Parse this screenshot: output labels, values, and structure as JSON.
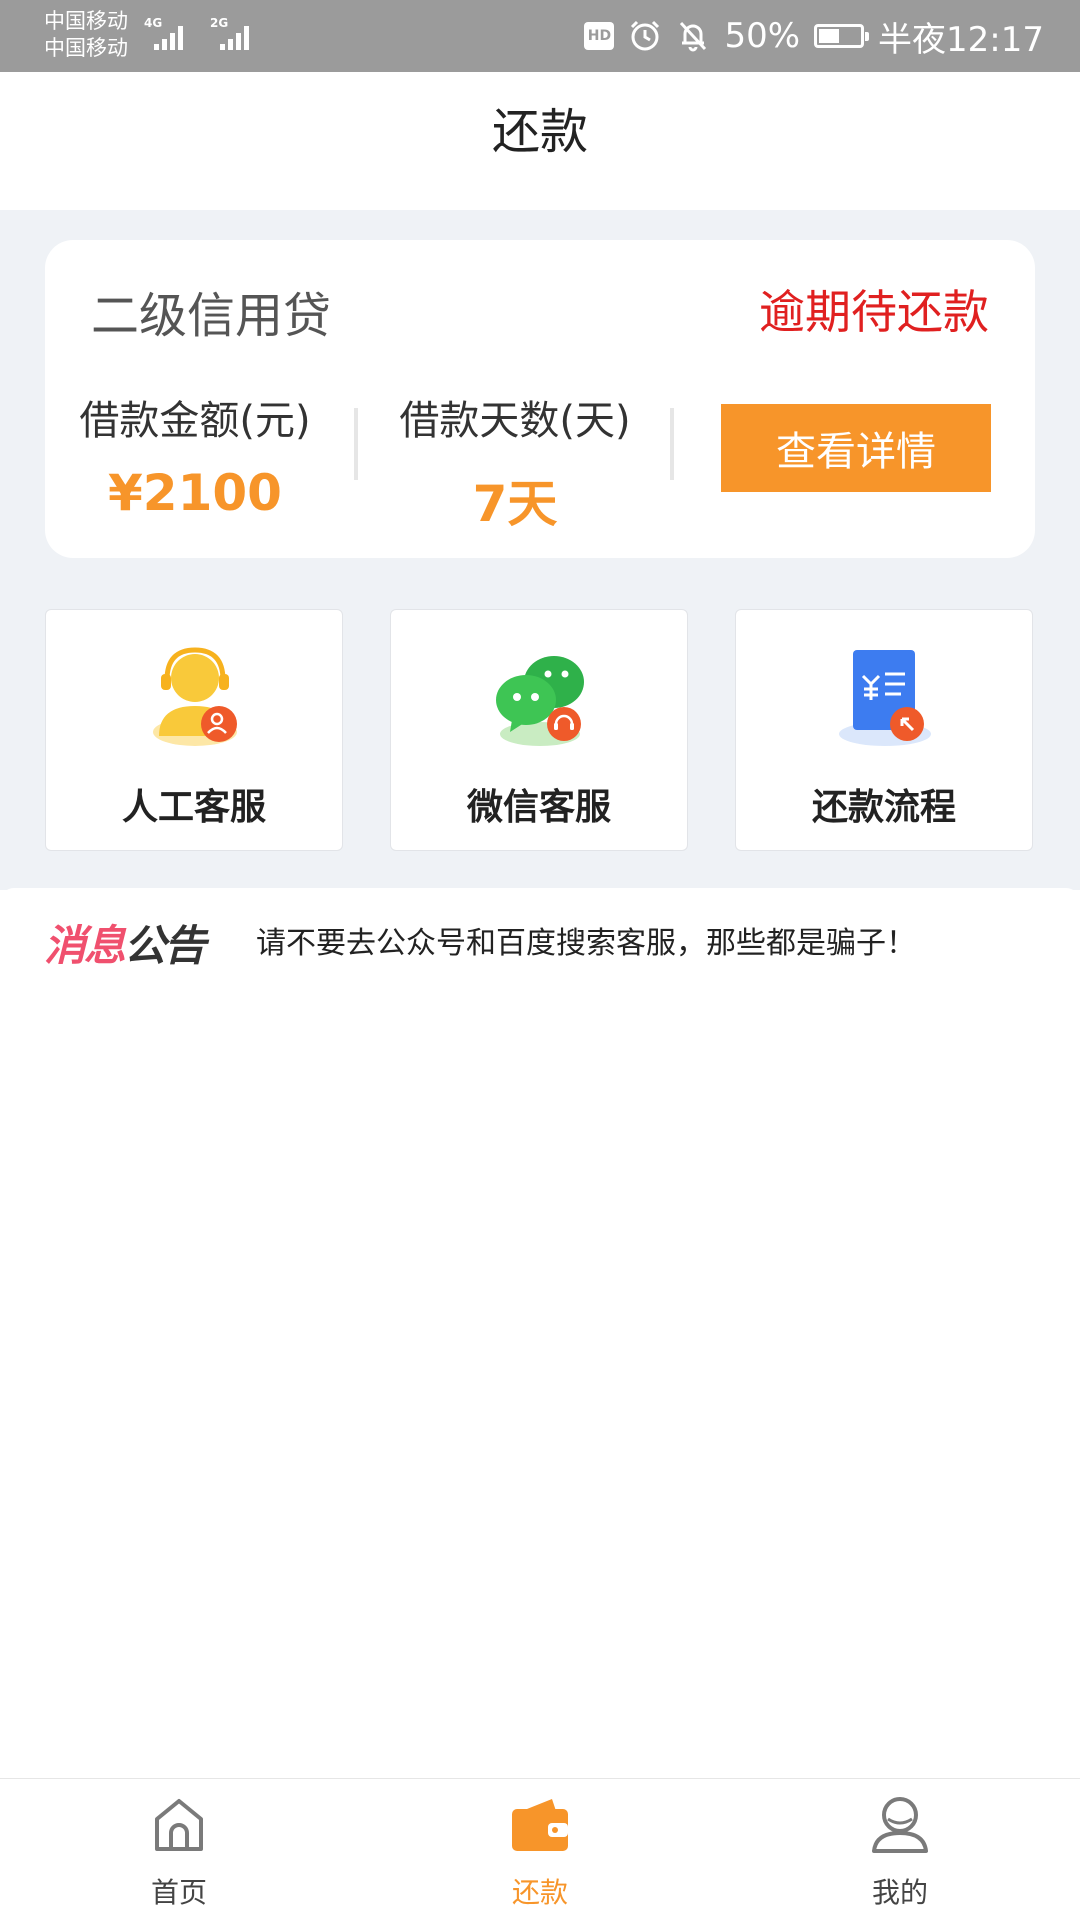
{
  "status_bar": {
    "carrier_1": "中国移动",
    "carrier_2": "中国移动",
    "network_1": "4G",
    "network_2": "2G",
    "battery_text": "50%",
    "battery_level": 0.5,
    "time": "半夜12:17",
    "icons": [
      "hd-icon",
      "alarm-icon",
      "bell-muted-icon",
      "battery-icon"
    ]
  },
  "header": {
    "title": "还款"
  },
  "loan": {
    "product_name": "二级信用贷",
    "status": "逾期待还款",
    "amount_label": "借款金额(元)",
    "amount_value": "¥2100",
    "days_label": "借款天数(天)",
    "days_value": "7天",
    "detail_button": "查看详情"
  },
  "services": [
    {
      "label": "人工客服",
      "icon": "customer-service-icon"
    },
    {
      "label": "微信客服",
      "icon": "wechat-icon"
    },
    {
      "label": "还款流程",
      "icon": "repayment-process-icon"
    }
  ],
  "notice": {
    "logo_part1": "消息",
    "logo_part2": "公告",
    "text": "请不要去公众号和百度搜索客服，那些都是骗子！"
  },
  "tabbar": {
    "items": [
      {
        "label": "首页",
        "icon": "home-icon",
        "active": false
      },
      {
        "label": "还款",
        "icon": "wallet-icon",
        "active": true
      },
      {
        "label": "我的",
        "icon": "profile-icon",
        "active": false
      }
    ]
  },
  "colors": {
    "accent": "#f7952a",
    "danger": "#e02020",
    "page_gray": "#eff2f6",
    "statusbar": "#9b9b9b"
  }
}
